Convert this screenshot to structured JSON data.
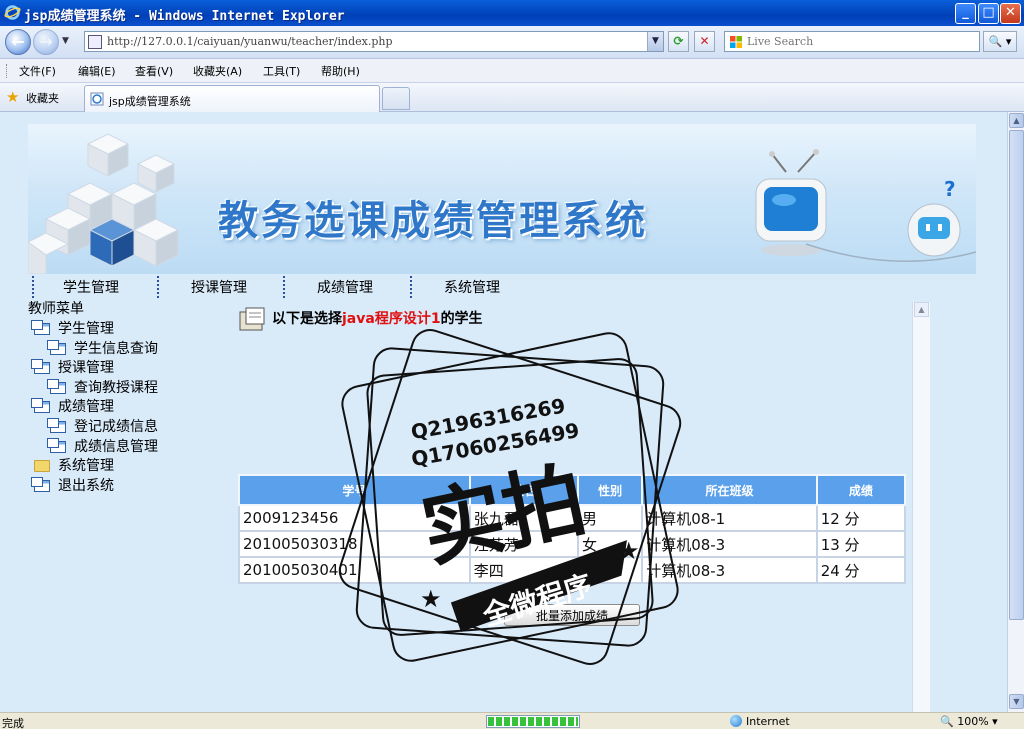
{
  "window": {
    "title": "jsp成绩管理系统 - Windows Internet Explorer",
    "minimize": "_",
    "maximize": "□",
    "close": "✕"
  },
  "address": {
    "url": "http://127.0.0.1/caiyuan/yuanwu/teacher/index.php",
    "search_placeholder": "Live Search",
    "search_button": "🔍 ▾"
  },
  "menu": [
    "文件(F)",
    "编辑(E)",
    "查看(V)",
    "收藏夹(A)",
    "工具(T)",
    "帮助(H)"
  ],
  "favorites": {
    "label": "收藏夹",
    "tab_title": "jsp成绩管理系统"
  },
  "banner": {
    "title": "教务选课成绩管理系统"
  },
  "topnav": [
    "学生管理",
    "授课管理",
    "成绩管理",
    "系统管理"
  ],
  "sidebar": {
    "header": "教师菜单",
    "items": [
      {
        "label": "学生管理",
        "level": 1,
        "icon": "window-icon"
      },
      {
        "label": "学生信息查询",
        "level": 2,
        "icon": "window-icon"
      },
      {
        "label": "授课管理",
        "level": 1,
        "icon": "window-icon"
      },
      {
        "label": "查询教授课程",
        "level": 2,
        "icon": "window-icon"
      },
      {
        "label": "成绩管理",
        "level": 1,
        "icon": "window-icon"
      },
      {
        "label": "登记成绩信息",
        "level": 2,
        "icon": "window-icon"
      },
      {
        "label": "成绩信息管理",
        "level": 2,
        "icon": "window-icon"
      },
      {
        "label": "系统管理",
        "level": 1,
        "icon": "folder-icon"
      },
      {
        "label": "退出系统",
        "level": 1,
        "icon": "window-icon"
      }
    ]
  },
  "main": {
    "heading_prefix": "以下是选择",
    "course": "java程序设计1",
    "heading_suffix": "的学生",
    "columns": [
      "学号",
      "姓名",
      "性别",
      "所在班级",
      "成绩"
    ],
    "rows": [
      [
        "2009123456",
        "张九磊",
        "男",
        "计算机08-1",
        "12 分"
      ],
      [
        "201005030318",
        "汪芳芳",
        "女",
        "计算机08-3",
        "13 分"
      ],
      [
        "201005030401",
        "李四",
        "男",
        "计算机08-3",
        "24 分"
      ]
    ],
    "batch_button": "批量添加成绩"
  },
  "watermark": {
    "qq": "Q2196316269",
    "phone": "Q17060256499",
    "big": "实拍",
    "sub": "全微程序"
  },
  "status": {
    "text": "完成",
    "progress": 1.0,
    "zone": "Internet",
    "zoom": "100%"
  },
  "colors": {
    "accent": "#5aa0ea",
    "course_highlight": "#e01010",
    "titlebar": "#0a5fd8"
  }
}
